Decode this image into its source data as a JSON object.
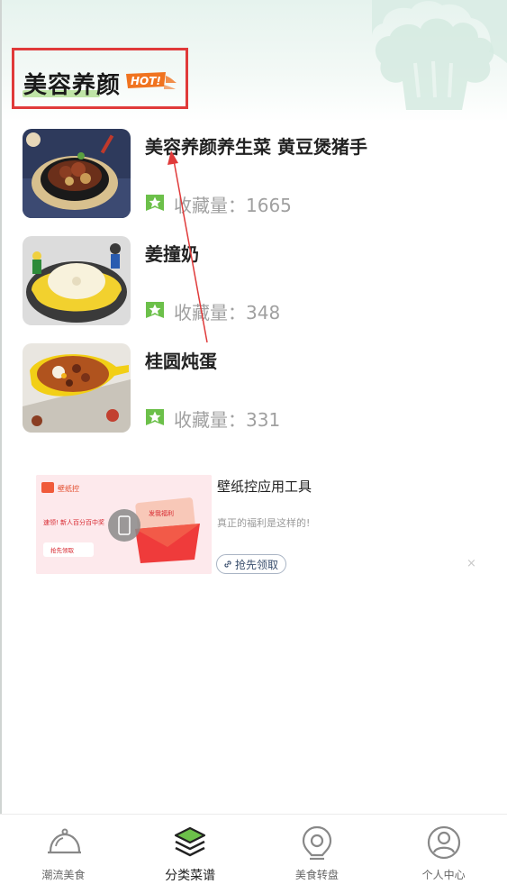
{
  "section": {
    "title": "美容养颜",
    "hot_badge": "HOT!"
  },
  "recipes": [
    {
      "name": "美容养颜养生菜 黄豆煲猪手",
      "favorites_label": "收藏量：",
      "favorites_count": "1665"
    },
    {
      "name": "姜撞奶",
      "favorites_label": "收藏量：",
      "favorites_count": "348"
    },
    {
      "name": "桂圆炖蛋",
      "favorites_label": "收藏量：",
      "favorites_count": "331"
    }
  ],
  "ad": {
    "title": "壁纸控应用工具",
    "description": "真正的福利是这样的!",
    "button_label": "抢先领取",
    "close": "×",
    "image": {
      "brand": "壁纸控",
      "line1": "速领! 新人百分百中奖",
      "button": "抢先领取",
      "envelope_text": "发我福利"
    }
  },
  "tabs": [
    {
      "label": "潮流美食",
      "icon": "cloche-icon"
    },
    {
      "label": "分类菜谱",
      "icon": "layers-icon",
      "active": true
    },
    {
      "label": "美食转盘",
      "icon": "map-pin-icon"
    },
    {
      "label": "个人中心",
      "icon": "person-icon"
    }
  ],
  "colors": {
    "accent_green": "#6cc04a",
    "highlight_red": "#e03a3a",
    "hot_orange": "#f0731f"
  }
}
